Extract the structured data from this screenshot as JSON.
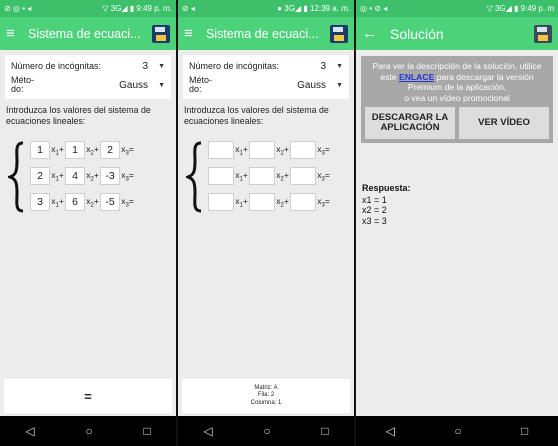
{
  "colors": {
    "statusbar": "#3cc06a",
    "appbar": "#4cd37a",
    "banner": "#a8a8a8",
    "link": "#2536d6"
  },
  "screens": [
    {
      "status": {
        "left_icons": "⊘ ◎ ▪ ◂",
        "right": "▽ 3G◢ ▮ 9:49 p. m."
      },
      "appbar": {
        "menu_icon": "≡",
        "title": "Sistema de ecuaci..."
      },
      "unknowns_label": "Número de incógnitas:",
      "unknowns_value": "3",
      "method_label": "Méto-\ndo:",
      "method_value": "Gauss",
      "intro": "Introduzca los valores del sistema de ecuaciones lineales:",
      "matrix": [
        [
          "1",
          "1",
          "2"
        ],
        [
          "2",
          "4",
          "-3"
        ],
        [
          "3",
          "6",
          "-5"
        ]
      ],
      "var_labels": {
        "x1": "x",
        "x2": "x",
        "x3": "x",
        "s1": "1",
        "s2": "2",
        "s3": "3",
        "plus": "+",
        "eq": "="
      },
      "bottom": "="
    },
    {
      "status": {
        "left_icons": "⊘ ◂",
        "right": "● 3G◢ ▮ 12:39 a. m."
      },
      "appbar": {
        "menu_icon": "≡",
        "title": "Sistema de ecuaci..."
      },
      "unknowns_label": "Número de incógnitas:",
      "unknowns_value": "3",
      "method_label": "Méto-\ndo:",
      "method_value": "Gauss",
      "intro": "Introduzca los valores del sistema de ecuaciones lineales:",
      "bottom_lines": [
        "Matriz: A",
        "Fila: 2",
        "Columna: 1"
      ]
    },
    {
      "status": {
        "left_icons": "◎ ▪ ⊘ ◂",
        "right": "▽ 3G◢ ▮ 9:49 p. m"
      },
      "appbar": {
        "back_icon": "←",
        "title": "Solución"
      },
      "banner_pre": "Para ver la descripción de la solución, utilice este ",
      "banner_link": "ENLACE",
      "banner_post": " para descargar la versión Premium de la aplicación,",
      "banner_post2": "o vea un vídeo promocional",
      "download_btn": "DESCARGAR LA APLICACIÓN",
      "video_btn": "VER VÍDEO",
      "answer_title": "Respuesta:",
      "answers": [
        "x1 = 1",
        "x2 = 2",
        "x3 = 3"
      ]
    }
  ],
  "nav": {
    "back": "◁",
    "home": "○",
    "recent": "□"
  }
}
